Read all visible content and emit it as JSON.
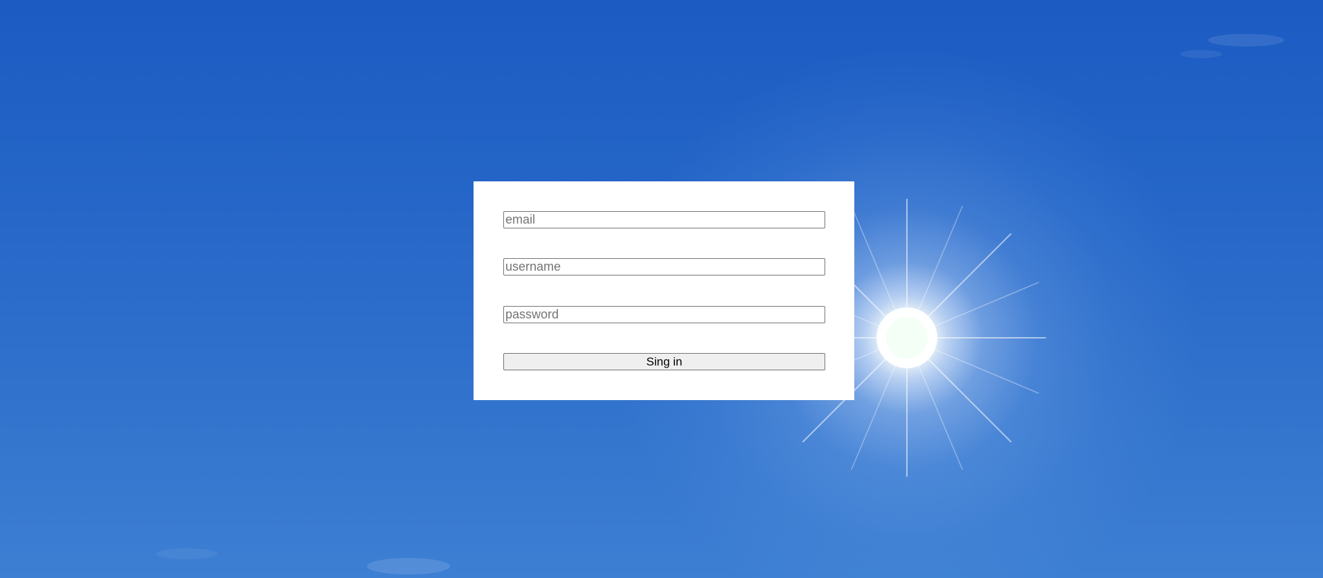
{
  "background": {
    "sky_color": "#1c5bc2",
    "sun_color": "#ffffff"
  },
  "form": {
    "email_placeholder": "email",
    "username_placeholder": "username",
    "password_placeholder": "password",
    "submit_label": "Sing in"
  }
}
